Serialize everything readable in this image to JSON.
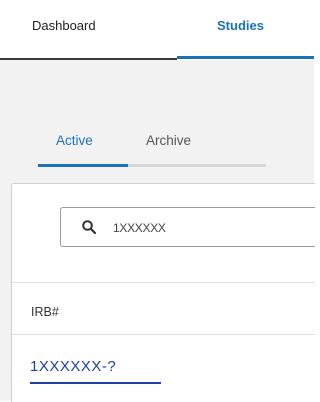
{
  "nav": {
    "items": [
      {
        "label": "Dashboard"
      },
      {
        "label": "Studies"
      }
    ],
    "active": "Studies"
  },
  "tabs": {
    "active_label": "Active",
    "archive_label": "Archive"
  },
  "search": {
    "value": "1XXXXXX",
    "icon": "search-icon"
  },
  "table": {
    "columns": [
      "IRB#"
    ],
    "rows": [
      {
        "irb": "1XXXXXX-?"
      }
    ]
  },
  "colors": {
    "accent": "#1a73b8",
    "link": "#1f3fa8",
    "background": "#f2f2f3"
  }
}
